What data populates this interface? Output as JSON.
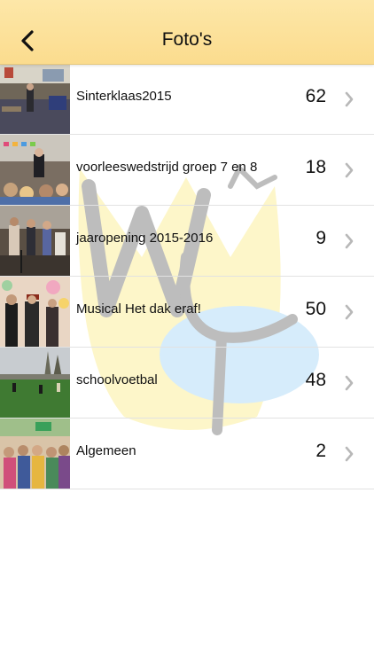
{
  "navbar": {
    "title": "Foto's",
    "back_icon": "chevron-left-icon"
  },
  "albums": [
    {
      "name": "Sinterklaas2015",
      "count": "62"
    },
    {
      "name": "voorleeswedstrijd groep 7 en 8",
      "count": "18"
    },
    {
      "name": "jaaropening 2015-2016",
      "count": "9"
    },
    {
      "name": "Musical Het dak eraf!",
      "count": "50"
    },
    {
      "name": "schoolvoetbal",
      "count": "48"
    },
    {
      "name": "Algemeen",
      "count": "2"
    }
  ],
  "colors": {
    "navbar": "#fbdc8e",
    "watermark_yellow": "#fdf6c9",
    "watermark_blue": "#d6ecfb",
    "watermark_stroke": "#bdbdbd",
    "chevron": "#b8b8b8"
  }
}
